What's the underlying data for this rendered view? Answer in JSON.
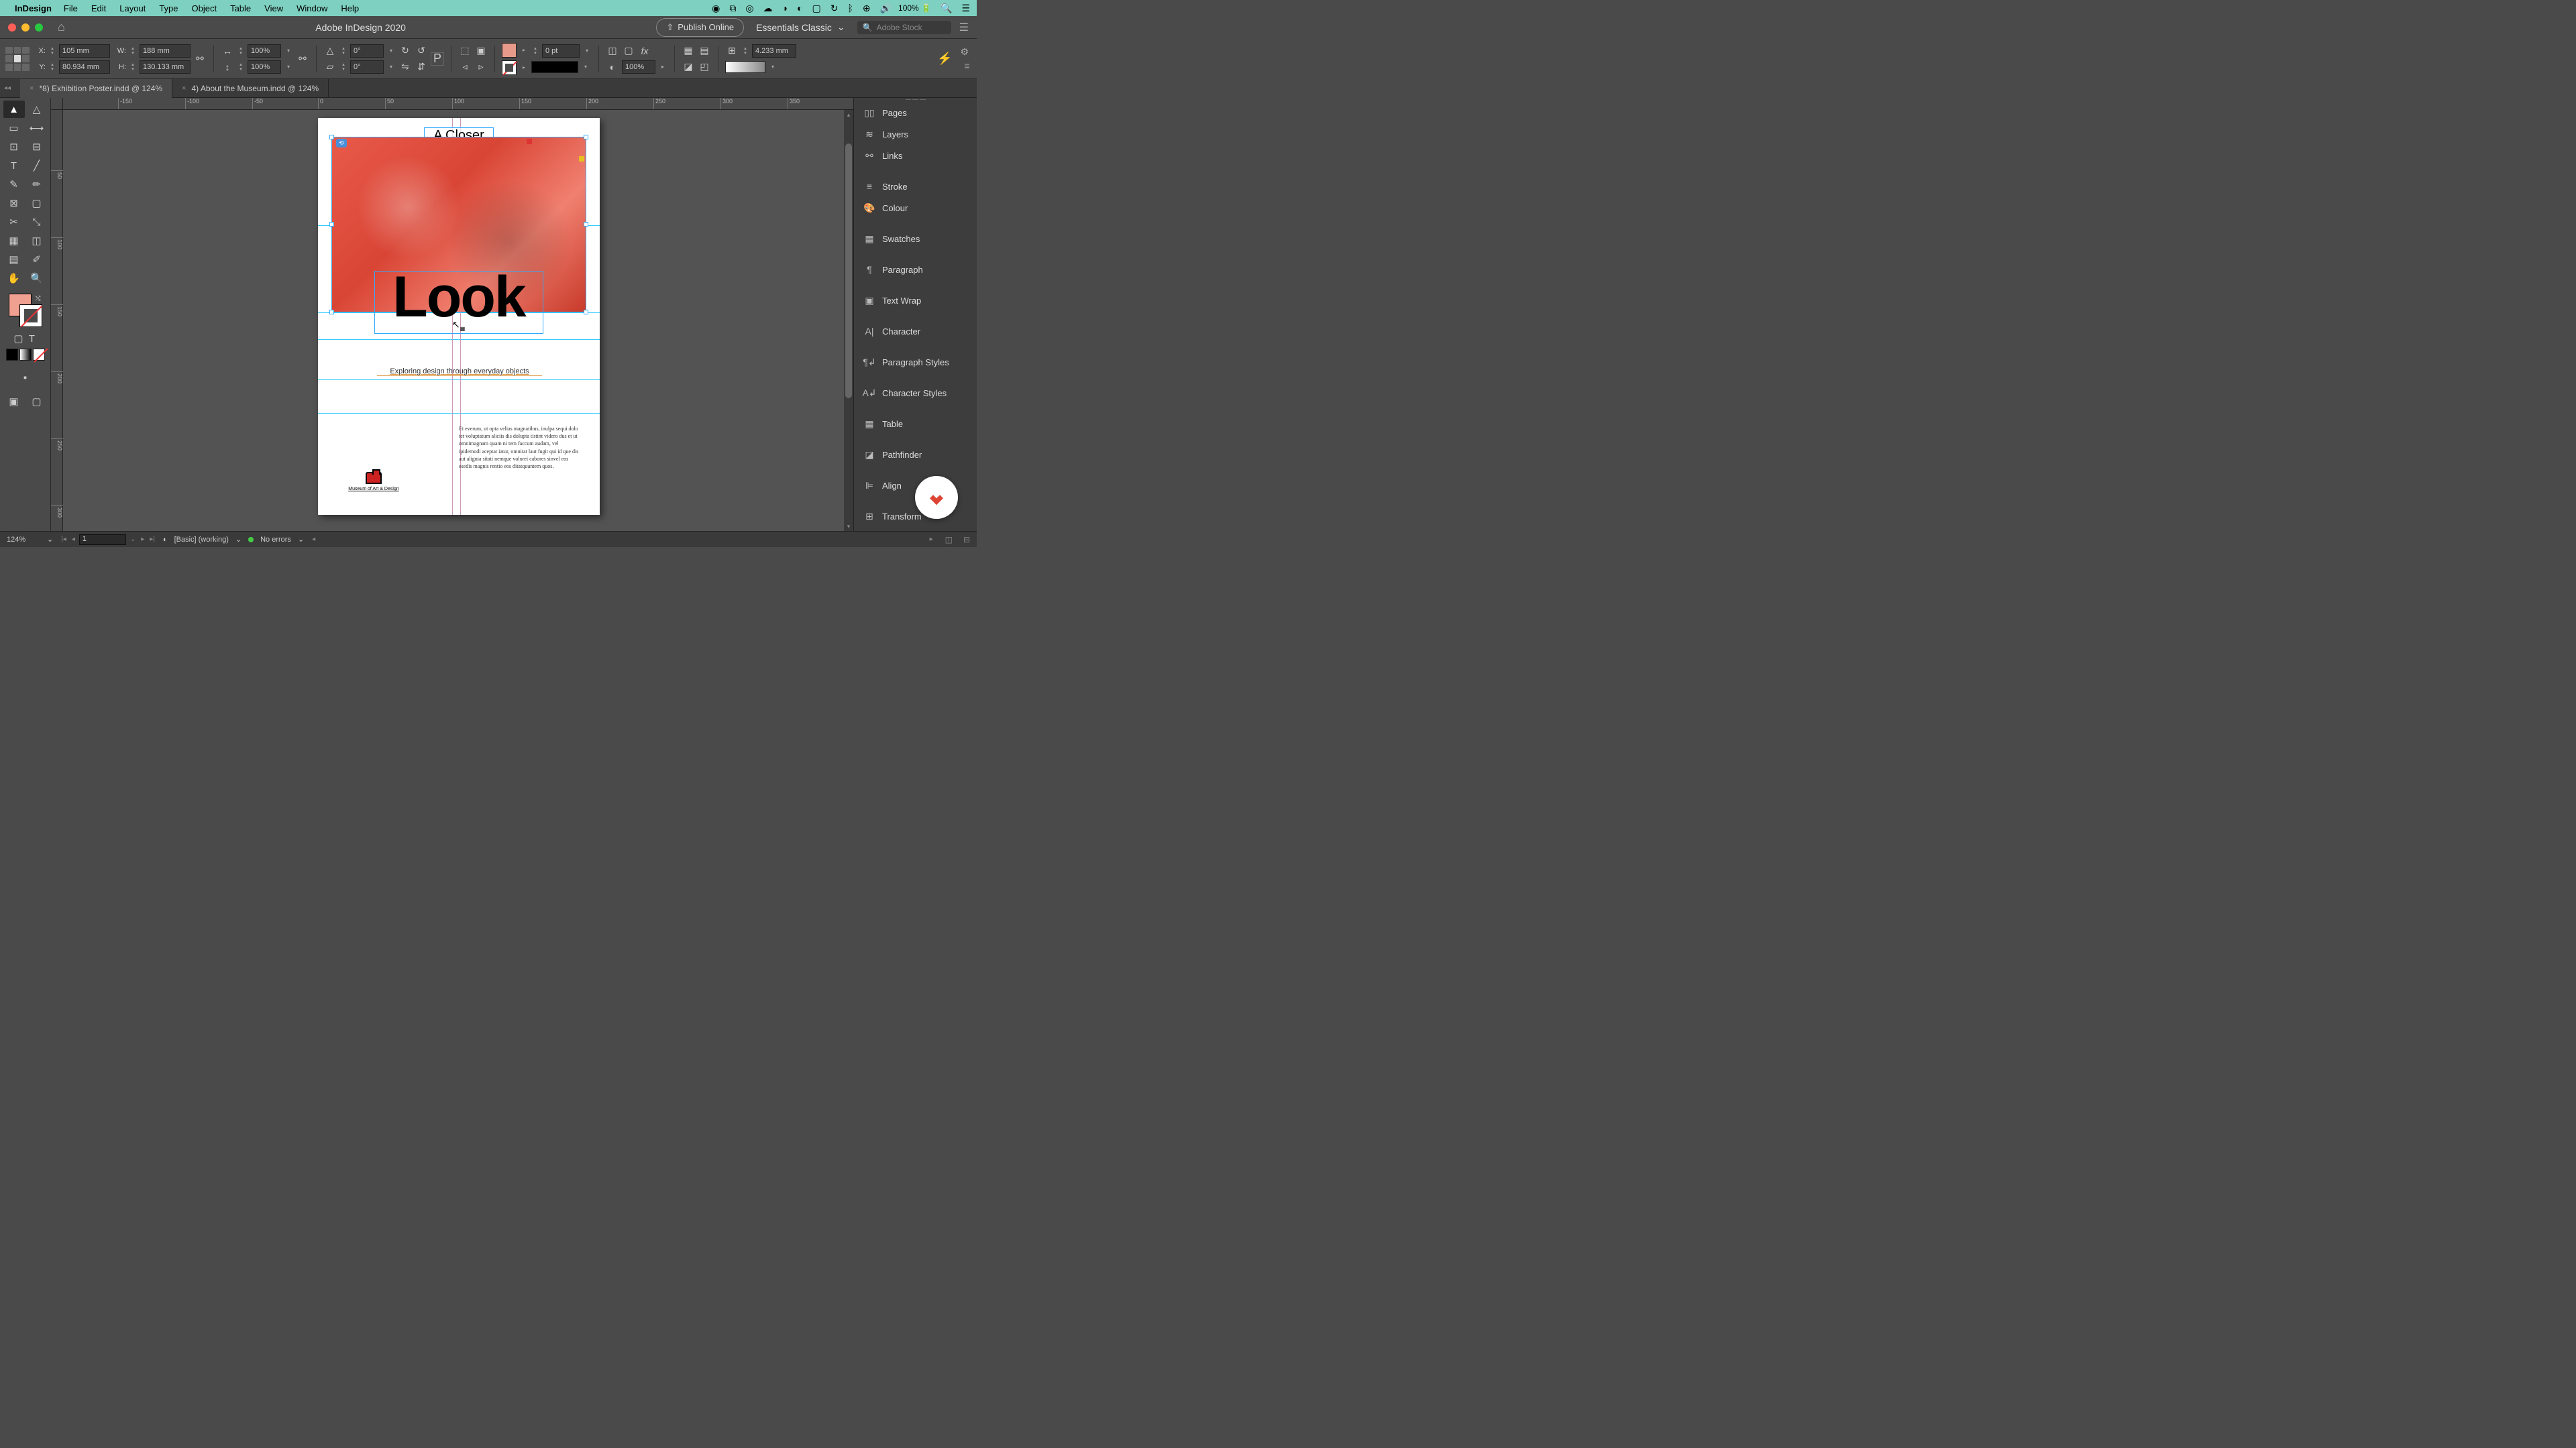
{
  "menubar": {
    "app": "InDesign",
    "items": [
      "File",
      "Edit",
      "Layout",
      "Type",
      "Object",
      "Table",
      "View",
      "Window",
      "Help"
    ],
    "battery": "100%",
    "battery_icon": "⚡"
  },
  "titlebar": {
    "title": "Adobe InDesign 2020",
    "publish": "Publish Online",
    "workspace": "Essentials Classic",
    "search_placeholder": "Adobe Stock"
  },
  "control": {
    "x": "105 mm",
    "y": "80.934 mm",
    "w": "188 mm",
    "h": "130.133 mm",
    "scale_x": "100%",
    "scale_y": "100%",
    "rotate": "0°",
    "shear": "0°",
    "stroke_weight": "0 pt",
    "opacity": "100%",
    "gap": "4.233 mm"
  },
  "tabs": [
    {
      "label": "*8) Exhibition Poster.indd @ 124%",
      "active": true
    },
    {
      "label": "4) About the Museum.indd @ 124%",
      "active": false
    }
  ],
  "ruler_h": [
    "-150",
    "-100",
    "-50",
    "0",
    "50",
    "100",
    "150",
    "200",
    "250",
    "300",
    "350"
  ],
  "ruler_v": [
    "50",
    "100",
    "150",
    "200",
    "250",
    "300"
  ],
  "document": {
    "title_overflow": "A Closer",
    "headline": "Look",
    "subtitle": "Exploring design through everyday objects",
    "body": "Et everum, ut opta velias magnatibus, inulpa sequi dolo tet voluptatum aliciis dis dolupta tistint videro dus et ut omnimagnam quam ni tem faccum audam, vel ipidemodi aceptat iatur, omnitat laut fugit qui id que dis aut alignia sitati nemque volorei cabores sinvel eos esedis magnis rentio eos ditatquuntem quos.",
    "logo_caption": "Museum of Art & Design"
  },
  "panels": [
    {
      "icon": "pages",
      "label": "Pages"
    },
    {
      "icon": "layers",
      "label": "Layers"
    },
    {
      "icon": "links",
      "label": "Links"
    },
    {
      "sep": true
    },
    {
      "icon": "stroke",
      "label": "Stroke"
    },
    {
      "icon": "colour",
      "label": "Colour"
    },
    {
      "sep": true
    },
    {
      "icon": "swatches",
      "label": "Swatches"
    },
    {
      "sep": true
    },
    {
      "icon": "paragraph",
      "label": "Paragraph"
    },
    {
      "sep": true
    },
    {
      "icon": "textwrap",
      "label": "Text Wrap"
    },
    {
      "sep": true
    },
    {
      "icon": "character",
      "label": "Character"
    },
    {
      "sep": true
    },
    {
      "icon": "pstyles",
      "label": "Paragraph Styles"
    },
    {
      "sep": true
    },
    {
      "icon": "cstyles",
      "label": "Character Styles"
    },
    {
      "sep": true
    },
    {
      "icon": "table",
      "label": "Table"
    },
    {
      "sep": true
    },
    {
      "icon": "pathfinder",
      "label": "Pathfinder"
    },
    {
      "sep": true
    },
    {
      "icon": "align",
      "label": "Align"
    },
    {
      "sep": true
    },
    {
      "icon": "transform",
      "label": "Transform"
    }
  ],
  "statusbar": {
    "zoom": "124%",
    "page": "1",
    "preflight_profile": "[Basic] (working)",
    "errors": "No errors"
  }
}
